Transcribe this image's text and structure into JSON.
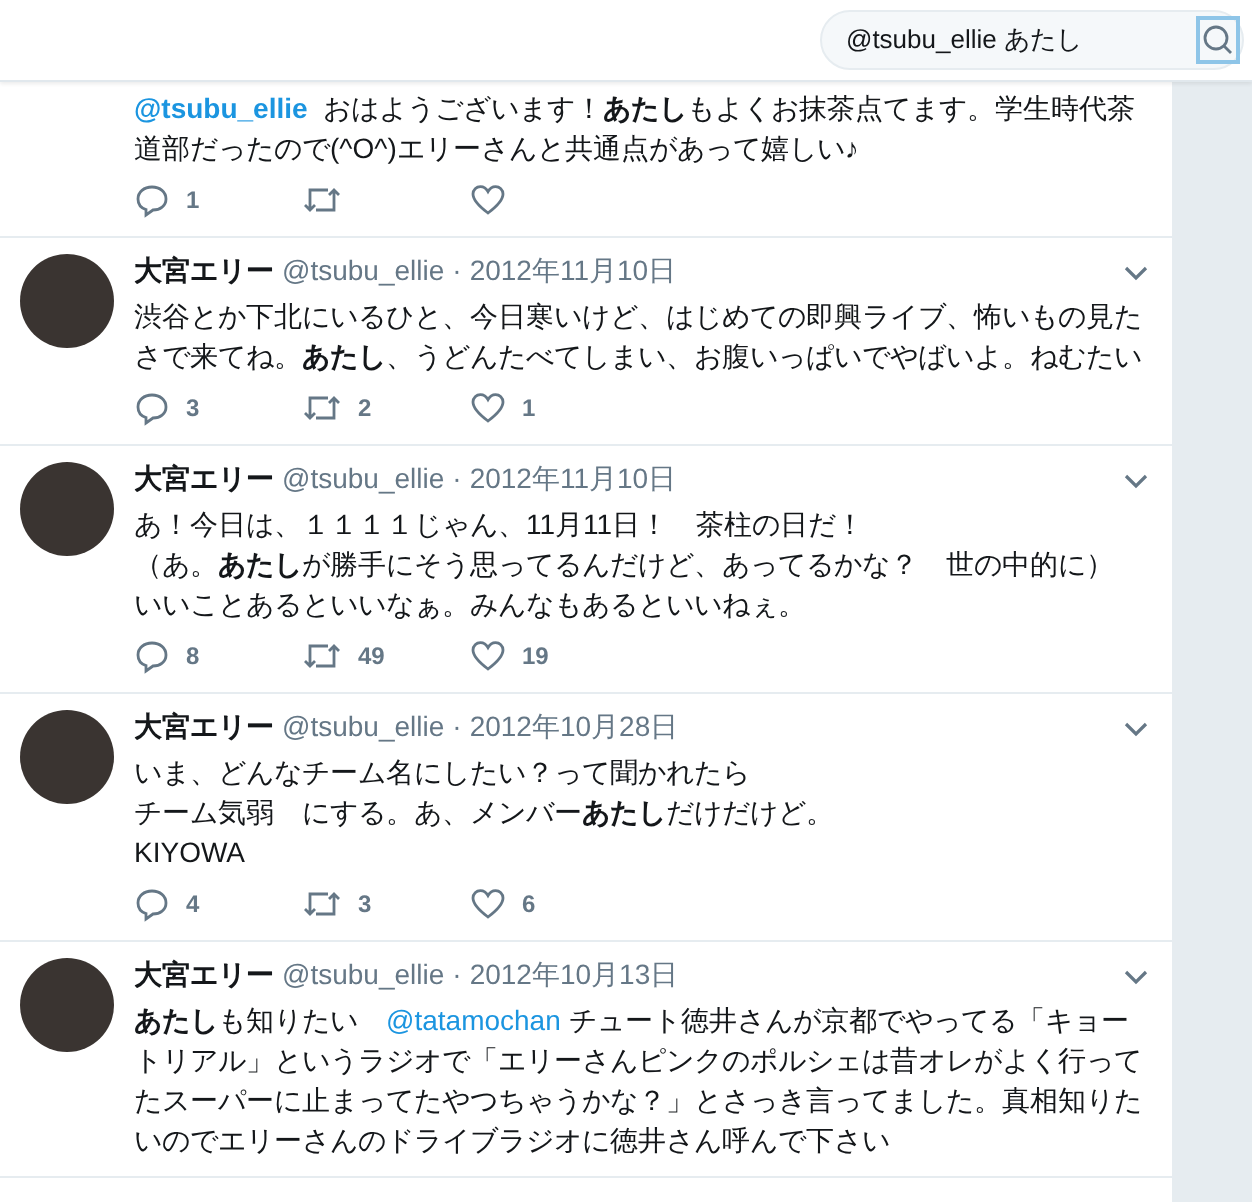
{
  "search": {
    "value": "@tsubu_ellie あたし"
  },
  "tweets": [
    {
      "lines": [
        [
          {
            "kind": "mention",
            "text": "@tsubu_ellie"
          },
          {
            "kind": "text",
            "text": " おはようございます！**あたし**もよくお抹茶点てます。学生時代茶道部だったので(^O^)エリーさんと共通点があって嬉しい♪"
          }
        ]
      ],
      "replies": "1"
    },
    {
      "name": "大宮エリー",
      "handle": "@tsubu_ellie",
      "separator": "·",
      "date": "2012年11月10日",
      "lines": [
        [
          {
            "kind": "text",
            "text": "渋谷とか下北にいるひと、今日寒いけど、はじめての即興ライブ、怖いもの見たさで来てね。**あたし**、うどんたべてしまい、お腹いっぱいでやばいよ。ねむたい"
          }
        ]
      ],
      "replies": "3",
      "retweets": "2",
      "likes": "1"
    },
    {
      "name": "大宮エリー",
      "handle": "@tsubu_ellie",
      "separator": "·",
      "date": "2012年11月10日",
      "lines": [
        [
          {
            "kind": "text",
            "text": "あ！今日は、１１１１じゃん、11月11日！　茶柱の日だ！"
          }
        ],
        [
          {
            "kind": "text",
            "text": "（あ。**あたし**が勝手にそう思ってるんだけど、あってるかな？　世の中的に）"
          }
        ],
        [
          {
            "kind": "text",
            "text": "いいことあるといいなぁ。みんなもあるといいねぇ。"
          }
        ]
      ],
      "replies": "8",
      "retweets": "49",
      "likes": "19"
    },
    {
      "name": "大宮エリー",
      "handle": "@tsubu_ellie",
      "separator": "·",
      "date": "2012年10月28日",
      "lines": [
        [
          {
            "kind": "text",
            "text": "いま、どんなチーム名にしたい？って聞かれたら"
          }
        ],
        [
          {
            "kind": "text",
            "text": "チーム気弱　にする。あ、メンバー**あたし**だけだけど。"
          }
        ],
        [
          {
            "kind": "text",
            "text": "KIYOWA"
          }
        ]
      ],
      "replies": "4",
      "retweets": "3",
      "likes": "6"
    },
    {
      "name": "大宮エリー",
      "handle": "@tsubu_ellie",
      "separator": "·",
      "date": "2012年10月13日",
      "lines": [
        [
          {
            "kind": "text",
            "text": "**あたし**も知りたい　"
          },
          {
            "kind": "mention",
            "text": "@tatamochan"
          },
          {
            "kind": "text",
            "text": " チュート徳井さんが京都でやってる「キョートリアル」というラジオで「エリーさんピンクのポルシェは昔オレがよく行ってたスーパーに止まってたやつちゃうかな？」とさっき言ってました。真相知りたいのでエリーさんのドライブラジオに徳井さん呼んで下さい"
          }
        ]
      ]
    }
  ]
}
